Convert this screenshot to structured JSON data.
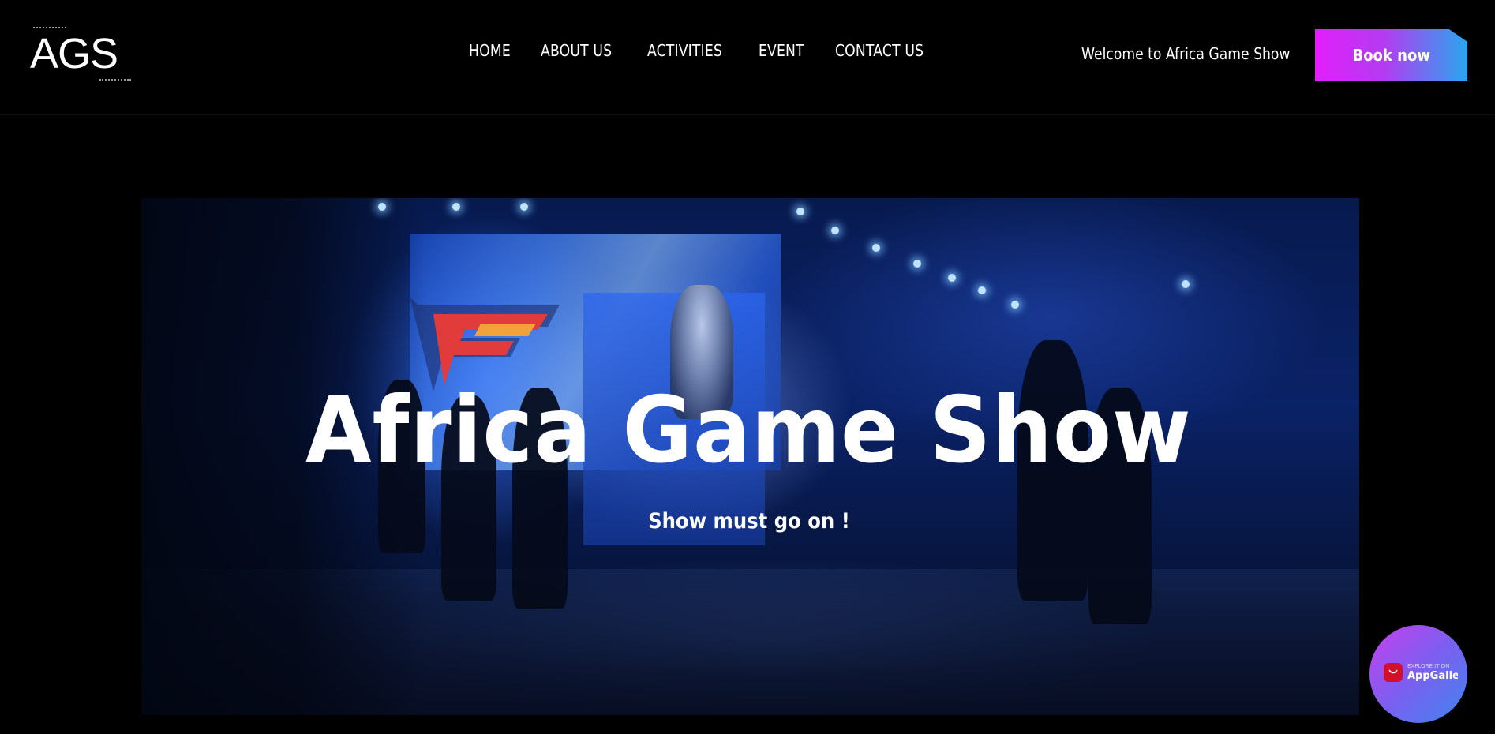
{
  "header": {
    "logo_text": "AGS",
    "nav": [
      {
        "label": "HOME"
      },
      {
        "label": "ABOUT US"
      },
      {
        "label": "ACTIVITIES"
      },
      {
        "label": "EVENT"
      },
      {
        "label": "CONTACT US"
      }
    ],
    "welcome_text": "Welcome to Africa Game Show",
    "book_label": "Book now"
  },
  "hero": {
    "title": "Africa Game Show",
    "subtitle": "Show must go on !"
  },
  "appgallery_badge": {
    "explore_text": "EXPLORE IT ON",
    "label": "AppGaller"
  },
  "colors": {
    "background": "#000000",
    "book_gradient_start": "#e11ffb",
    "book_gradient_end": "#2aa6ef",
    "badge_gradient_start": "#c640ee",
    "badge_gradient_end": "#3f86ee",
    "huawei_red": "#d3102c"
  }
}
